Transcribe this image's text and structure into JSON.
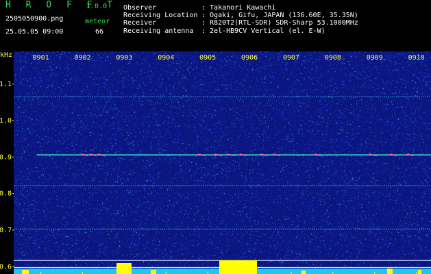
{
  "app": {
    "name": "H R O F F T",
    "version": "1.0.0",
    "mode_label": "meteor",
    "count": "66"
  },
  "file": {
    "name": "2505050900.png",
    "datetime": "25.05.05 09:00"
  },
  "info": {
    "labels": [
      "Observer",
      "Receiving Location",
      "Receiver",
      "Receiving antenna"
    ],
    "values": [
      ": Takanori Kawachi",
      ": Ogaki, Gifu, JAPAN (136.60E, 35.35N)",
      ": R820T2(RTL-SDR) SDR-Sharp 53.1000MHz",
      ": 2el-HB9CV Vertical (el. E-W)"
    ]
  },
  "chart_data": {
    "type": "heatmap",
    "ylabel": "kHz",
    "x_ticks": [
      "0901",
      "0902",
      "0903",
      "0904",
      "0905",
      "0906",
      "0907",
      "0908",
      "0909",
      "0910"
    ],
    "y_ticks": [
      1.1,
      1.0,
      0.9,
      0.8,
      0.7,
      0.6
    ],
    "ylim": [
      0.58,
      1.18
    ],
    "xlim_minutes": [
      0,
      10
    ],
    "carrier_khz": 0.906,
    "carrier_start_minute": 0.55,
    "faint_lines_khz": [
      0.822,
      0.703,
      1.065
    ],
    "meteor_bursts_minute": [
      1.7,
      1.9,
      2.1,
      4.5,
      4.9,
      5.2,
      5.5,
      6.0,
      6.3,
      7.3,
      8.6,
      9.1,
      9.5
    ]
  },
  "colors": {
    "background": "#0b1680",
    "noise": [
      "#1a2fd0",
      "#2a55f0",
      "#2e9fe8",
      "#36d4d0",
      "#8fe0ff"
    ],
    "carrier": "#3fe3c7",
    "axis_text": "#ffff33",
    "header_text": "#2fe04a",
    "bottom_bar": "#19c9f0",
    "yellow_burst": "#ffff00"
  }
}
